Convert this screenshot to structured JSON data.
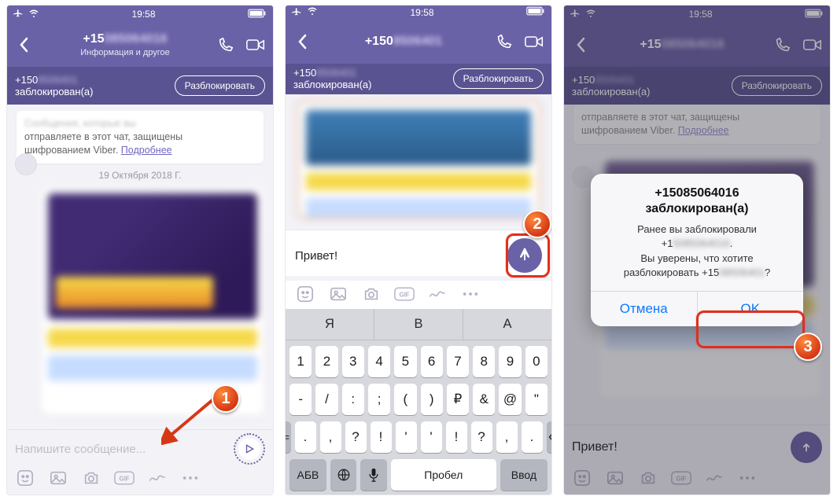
{
  "status": {
    "time": "19:58"
  },
  "header": {
    "phone_prefix": "+15",
    "phone_blur": "085064016",
    "subtitle": "Информация и другое"
  },
  "banner": {
    "number_prefix": "+150",
    "number_blur": "8506401",
    "blocked_text": "заблокирован(а)",
    "unblock": "Разблокировать"
  },
  "notice": {
    "line1_prefix": "Сообщения, которые вы",
    "line2": "отправляете в этот чат, защищены",
    "line3_prefix": "шифрованием Viber.",
    "more": "Подробнее"
  },
  "date": "19 Октября 2018 Г.",
  "compose": {
    "placeholder": "Напишите сообщение...",
    "typed": "Привет!"
  },
  "suggestions": {
    "s1": "Я",
    "s2": "В",
    "s3": "А"
  },
  "keys": {
    "row1": [
      "1",
      "2",
      "3",
      "4",
      "5",
      "6",
      "7",
      "8",
      "9",
      "0"
    ],
    "row2": [
      "-",
      "/",
      ":",
      ";",
      "(",
      ")",
      "₽",
      "&",
      "@",
      "\""
    ],
    "symKey": "#+=",
    "row3": [
      ".",
      ",",
      "?",
      "!",
      "'"
    ],
    "abc": "АБВ",
    "space": "Пробел",
    "enter": "Ввод"
  },
  "alert": {
    "title_prefix": "+15",
    "title_blur": "085064016",
    "title_line2": "заблокирован(а)",
    "body1": "Ранее вы заблокировали",
    "body2_prefix": "+1",
    "body2_blur": "5085064016",
    "body3": "Вы уверены, что хотите",
    "body4_prefix": "разблокировать +15",
    "body4_blur": "08506401",
    "body4_suffix": "?",
    "cancel": "Отмена",
    "ok": "OK"
  },
  "header2": {
    "prefix": "+150",
    "blur": "8506401"
  },
  "header3": {
    "prefix": "+15",
    "blur": "085064016"
  }
}
